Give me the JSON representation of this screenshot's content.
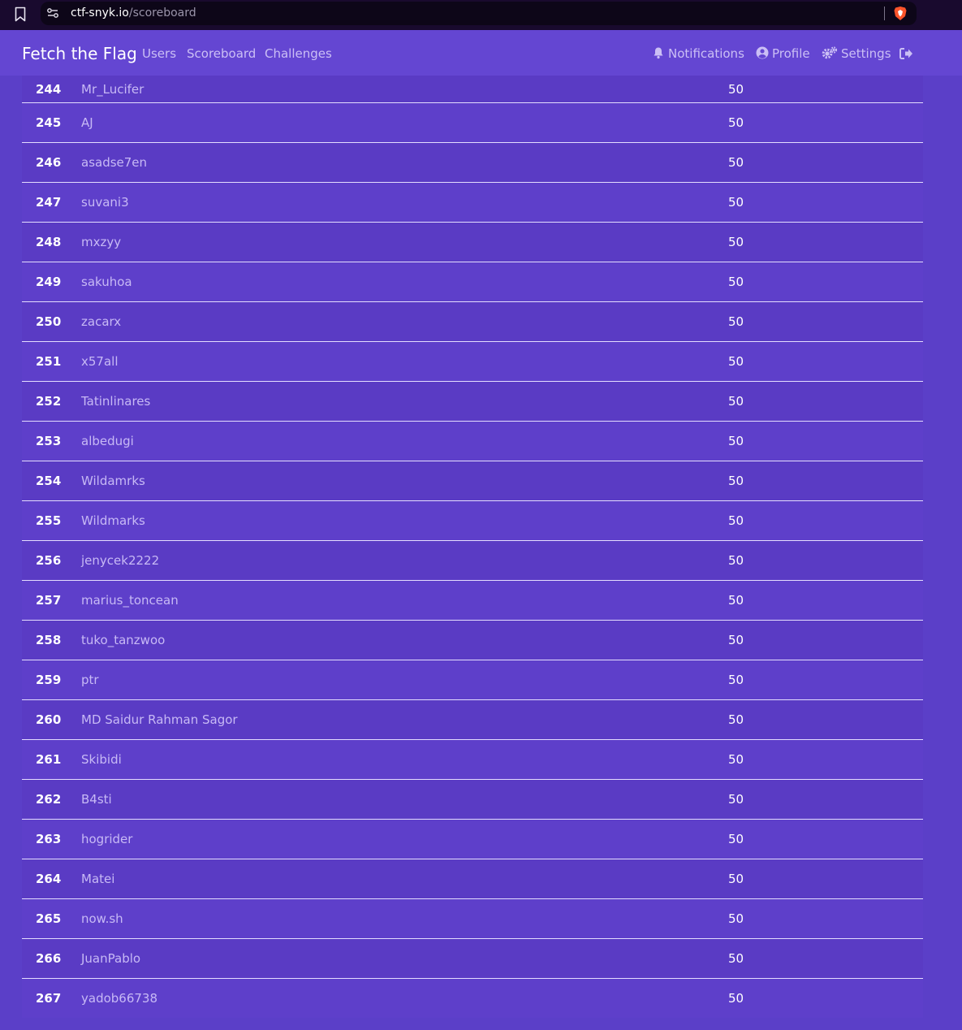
{
  "browser": {
    "url_host": "ctf-snyk.io",
    "url_path": "/scoreboard",
    "icons": [
      "bookmark-icon",
      "site-info-icon",
      "brave-shield-icon"
    ]
  },
  "nav": {
    "brand": "Fetch the Flag",
    "links": [
      "Users",
      "Scoreboard",
      "Challenges"
    ],
    "notifications_label": "Notifications",
    "profile_label": "Profile",
    "settings_label": "Settings",
    "icons": [
      "bell-icon",
      "user-circle-icon",
      "gears-icon",
      "logout-icon"
    ]
  },
  "colors": {
    "page_bg": "#5b3fc8",
    "navbar_bg": "#6446d2",
    "browser_bar_bg": "#190a2e",
    "row_divider": "#e4ddff",
    "link_text": "#c7b9f5",
    "text": "#ffffff"
  },
  "scoreboard": {
    "rows": [
      {
        "place": "244",
        "name": "Mr_Lucifer",
        "score": "50"
      },
      {
        "place": "245",
        "name": "AJ",
        "score": "50"
      },
      {
        "place": "246",
        "name": "asadse7en",
        "score": "50"
      },
      {
        "place": "247",
        "name": "suvani3",
        "score": "50"
      },
      {
        "place": "248",
        "name": "mxzyy",
        "score": "50"
      },
      {
        "place": "249",
        "name": "sakuhoa",
        "score": "50"
      },
      {
        "place": "250",
        "name": "zacarx",
        "score": "50"
      },
      {
        "place": "251",
        "name": "x57all",
        "score": "50"
      },
      {
        "place": "252",
        "name": "Tatinlinares",
        "score": "50"
      },
      {
        "place": "253",
        "name": "albedugi",
        "score": "50"
      },
      {
        "place": "254",
        "name": "Wildamrks",
        "score": "50"
      },
      {
        "place": "255",
        "name": "Wildmarks",
        "score": "50"
      },
      {
        "place": "256",
        "name": "jenycek2222",
        "score": "50"
      },
      {
        "place": "257",
        "name": "marius_toncean",
        "score": "50"
      },
      {
        "place": "258",
        "name": "tuko_tanzwoo",
        "score": "50"
      },
      {
        "place": "259",
        "name": "ptr",
        "score": "50"
      },
      {
        "place": "260",
        "name": "MD Saidur Rahman Sagor",
        "score": "50"
      },
      {
        "place": "261",
        "name": "Skibidi",
        "score": "50"
      },
      {
        "place": "262",
        "name": "B4sti",
        "score": "50"
      },
      {
        "place": "263",
        "name": "hogrider",
        "score": "50"
      },
      {
        "place": "264",
        "name": "Matei",
        "score": "50"
      },
      {
        "place": "265",
        "name": "now.sh",
        "score": "50"
      },
      {
        "place": "266",
        "name": "JuanPablo",
        "score": "50"
      },
      {
        "place": "267",
        "name": "yadob66738",
        "score": "50"
      }
    ]
  }
}
